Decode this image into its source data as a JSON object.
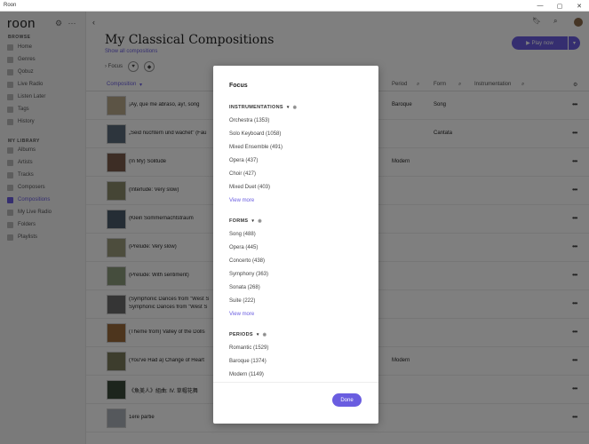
{
  "window": {
    "title": "Roon",
    "controls": [
      "—",
      "▢",
      "✕"
    ]
  },
  "sidebar": {
    "logo": "roon",
    "browse_heading": "BROWSE",
    "browse_items": [
      "Home",
      "Genres",
      "Qobuz",
      "Live Radio",
      "Listen Later",
      "Tags",
      "History"
    ],
    "library_heading": "MY LIBRARY",
    "library_items": [
      "Albums",
      "Artists",
      "Tracks",
      "Composers",
      "Compositions",
      "My Live Radio",
      "Folders",
      "Playlists"
    ],
    "active_item": "Compositions"
  },
  "main": {
    "back_glyph": "‹",
    "title": "My Classical Compositions",
    "subtitle": "Show all compositions",
    "play_now": "▶  Play now",
    "play_more": "▾",
    "focus_label": "› Focus",
    "columns": {
      "composition": "Composition",
      "period": "Period",
      "form": "Form",
      "instrumentation": "Instrumentation"
    },
    "rows": [
      {
        "name": "¡Ay, que me abraso, ay!, song",
        "period": "Baroque",
        "form": "Song"
      },
      {
        "name": "„Seid nüchtern und wachet\" (Fau",
        "period": "",
        "form": "Cantata"
      },
      {
        "name": "(In My) Solitude",
        "period": "Modern",
        "form": ""
      },
      {
        "name": "(Interlude: Very slow)",
        "period": "",
        "form": ""
      },
      {
        "name": "(Klein Sommernachtstraum",
        "period": "",
        "form": ""
      },
      {
        "name": "(Prelude: Very slow)",
        "period": "",
        "form": ""
      },
      {
        "name": "(Prelude: With sentiment)",
        "period": "",
        "form": ""
      },
      {
        "name": "(Symphonic Dances from \"West S",
        "name2": "Symphonic Dances from \"West S",
        "period": "",
        "form": ""
      },
      {
        "name": "(Theme from) Valley of the Dolls",
        "period": "",
        "form": ""
      },
      {
        "name": "(You've Had a) Change of Heart",
        "period": "Modern",
        "form": ""
      },
      {
        "name": "《魚美人》組曲: IV. 草帽花舞",
        "period": "",
        "form": ""
      },
      {
        "name": "1ere partie",
        "period": "",
        "form": ""
      }
    ]
  },
  "modal": {
    "title": "Focus",
    "groups": [
      {
        "heading": "INSTRUMENTATIONS",
        "options": [
          "Orchestra (1353)",
          "Solo Keyboard (1058)",
          "Mixed Ensemble (491)",
          "Opera (437)",
          "Choir (427)",
          "Mixed Duet (403)"
        ],
        "more": "View more"
      },
      {
        "heading": "FORMS",
        "options": [
          "Song (488)",
          "Opera (445)",
          "Concerto (438)",
          "Symphony (363)",
          "Sonata (268)",
          "Suite (222)"
        ],
        "more": "View more"
      },
      {
        "heading": "PERIODS",
        "options": [
          "Romantic (1529)",
          "Baroque (1374)",
          "Modern (1149)"
        ],
        "more": ""
      }
    ],
    "done_label": "Done"
  },
  "colors": {
    "accent": "#6a5de0"
  }
}
